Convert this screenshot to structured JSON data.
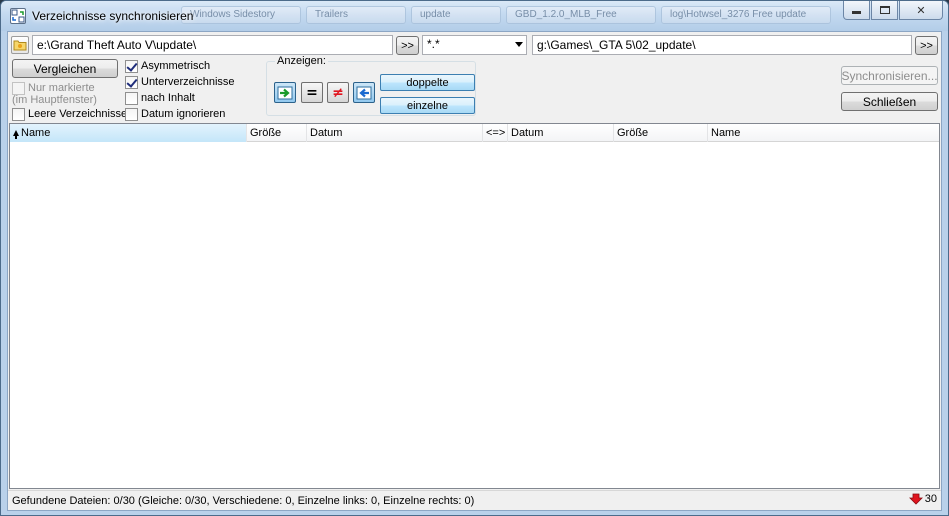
{
  "window": {
    "title": "Verzeichnisse synchronisieren",
    "ghost_tabs": [
      "Windows Sidestory",
      "Trailers",
      "update",
      "GBD_1.2.0_MLB_Free",
      "log\\Hotwsel_3276 Free update"
    ]
  },
  "top": {
    "left_path": "e:\\Grand Theft Auto V\\update\\",
    "left_browse_label": ">>",
    "filter_mask": "*.*",
    "right_path": "g:\\Games\\_GTA 5\\02_update\\",
    "right_browse_label": ">>"
  },
  "options": {
    "compare_label": "Vergleichen",
    "only_marked_label": "Nur markierte",
    "only_marked_sub": "(im Hauptfenster)",
    "empty_dirs_label": "Leere Verzeichnisse",
    "asymmetric_label": "Asymmetrisch",
    "subdirs_label": "Unterverzeichnisse",
    "by_content_label": "nach Inhalt",
    "ignore_date_label": "Datum ignorieren"
  },
  "show": {
    "title": "Anzeigen:",
    "equal_symbol": "=",
    "unequal_symbol": "≠",
    "duplicates_label": "doppelte",
    "singles_label": "einzelne"
  },
  "actions": {
    "synchronize_label": "Synchronisieren...",
    "close_label": "Schließen"
  },
  "columns": {
    "left_name": "Name",
    "left_size": "Größe",
    "left_date": "Datum",
    "compare": "<=>",
    "right_date": "Datum",
    "right_size": "Größe",
    "right_name": "Name"
  },
  "status": {
    "text": "Gefundene Dateien: 0/30  (Gleiche: 0/30, Verschiedene: 0, Einzelne links: 0, Einzelne rechts: 0)",
    "count": "30"
  },
  "icons": {
    "app": "sync-dirs-icon",
    "folder": "folder-icon",
    "copy_right": "arrow-right-icon",
    "copy_left": "arrow-left-icon",
    "status_down": "red-down-arrow-icon"
  },
  "colors": {
    "accent_blue": "#3c7fb1",
    "unequal_red": "#e0141e",
    "arrow_green": "#1a9a2a"
  }
}
